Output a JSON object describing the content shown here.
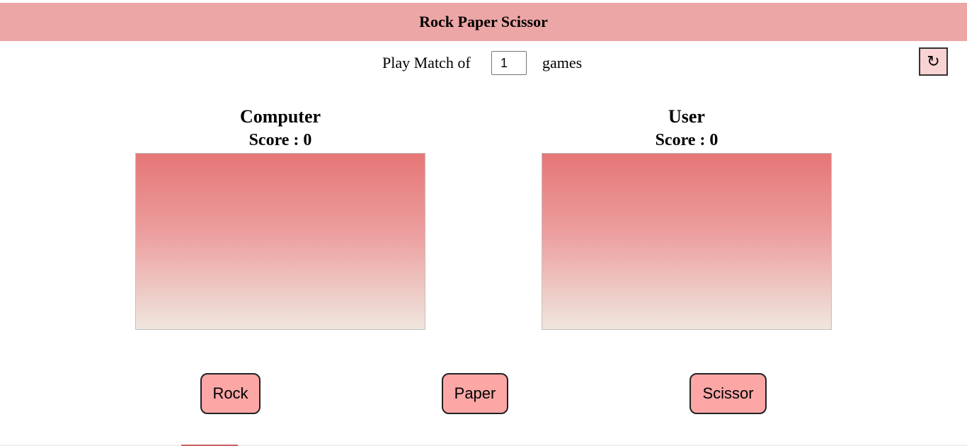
{
  "header": {
    "title": "Rock Paper Scissor"
  },
  "match": {
    "label": "Play Match of",
    "games_value": "1",
    "suffix": "games"
  },
  "reset": {
    "icon": "refresh-icon",
    "glyph": "↻"
  },
  "computer": {
    "name": "Computer",
    "score_text": "Score : 0"
  },
  "user": {
    "name": "User",
    "score_text": "Score : 0"
  },
  "choices": [
    "Rock",
    "Paper",
    "Scissor"
  ],
  "colors": {
    "header": "#eda6a6",
    "button": "#fca6a6",
    "panel_top": "#e67676",
    "panel_bottom": "#f0e6de"
  }
}
